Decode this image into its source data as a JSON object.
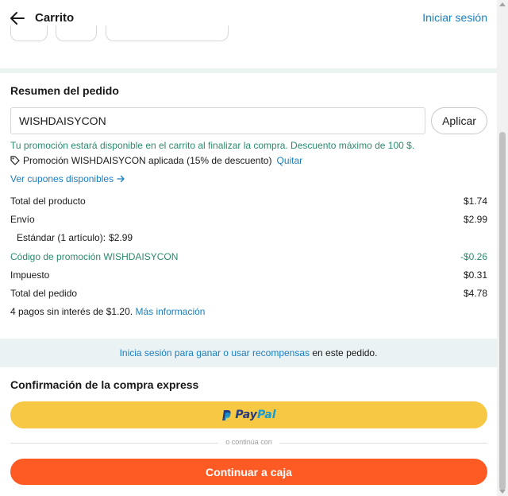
{
  "header": {
    "title": "Carrito",
    "login_link": "Iniciar sesión"
  },
  "summary": {
    "title": "Resumen del pedido",
    "promo_code_value": "WISHDAISYCON",
    "apply_label": "Aplicar",
    "promo_message": "Tu promoción estará disponible en el carrito al finalizar la compra. Descuento máximo de 100 $.",
    "applied_text": "Promoción WISHDAISYCON aplicada (15% de descuento)",
    "remove_label": "Quitar",
    "coupons_link": "Ver cupones disponibles",
    "rows": {
      "product_total": {
        "label": "Total del producto",
        "value": "$1.74"
      },
      "shipping": {
        "label": "Envío",
        "value": "$2.99"
      },
      "standard": {
        "label": "Estándar (1 artículo):",
        "value": "$2.99"
      },
      "promo": {
        "label": "Código de promoción WISHDAISYCON",
        "value": "-$0.26"
      },
      "tax": {
        "label": "Impuesto",
        "value": "$0.31"
      },
      "order_total": {
        "label": "Total del pedido",
        "value": "$4.78"
      }
    },
    "installments_text": "4 pagos sin interés de $1.20.",
    "installments_link": "Más información"
  },
  "rewards": {
    "link": "Inicia sesión para ganar o usar recompensas",
    "suffix": " en este pedido."
  },
  "express": {
    "title": "Confirmación de la compra express",
    "paypal_a": "Pay",
    "paypal_b": "Pal",
    "or_text": "o continúa con",
    "checkout_label": "Continuar a caja"
  },
  "colors": {
    "accent_link": "#1a7fc1",
    "promo_green": "#2b8a6e",
    "paypal_yellow": "#f7c843",
    "checkout_orange": "#fe5a24"
  }
}
